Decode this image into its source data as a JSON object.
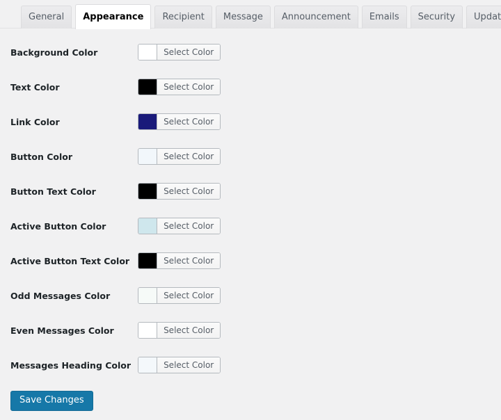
{
  "tabs": [
    {
      "label": "General",
      "active": false
    },
    {
      "label": "Appearance",
      "active": true
    },
    {
      "label": "Recipient",
      "active": false
    },
    {
      "label": "Message",
      "active": false
    },
    {
      "label": "Announcement",
      "active": false
    },
    {
      "label": "Emails",
      "active": false
    },
    {
      "label": "Security",
      "active": false
    },
    {
      "label": "Update",
      "active": false
    }
  ],
  "settings": {
    "select_color_label": "Select Color",
    "rows": [
      {
        "label": "Background Color",
        "color": "#ffffff"
      },
      {
        "label": "Text Color",
        "color": "#000000"
      },
      {
        "label": "Link Color",
        "color": "#1a1a7a"
      },
      {
        "label": "Button Color",
        "color": "#f2f7fb"
      },
      {
        "label": "Button Text Color",
        "color": "#000000"
      },
      {
        "label": "Active Button Color",
        "color": "#cfe7ed"
      },
      {
        "label": "Active Button Text Color",
        "color": "#000000"
      },
      {
        "label": "Odd Messages Color",
        "color": "#f6faf8"
      },
      {
        "label": "Even Messages Color",
        "color": "#ffffff"
      },
      {
        "label": "Messages Heading Color",
        "color": "#f4f8fb"
      }
    ]
  },
  "submit": {
    "save_label": "Save Changes"
  },
  "theme": {
    "page_background": "#f1f1f2",
    "primary_button": "#1678a8",
    "tab_active_background": "#ffffff",
    "tab_inactive_background": "#e6e6e8"
  }
}
